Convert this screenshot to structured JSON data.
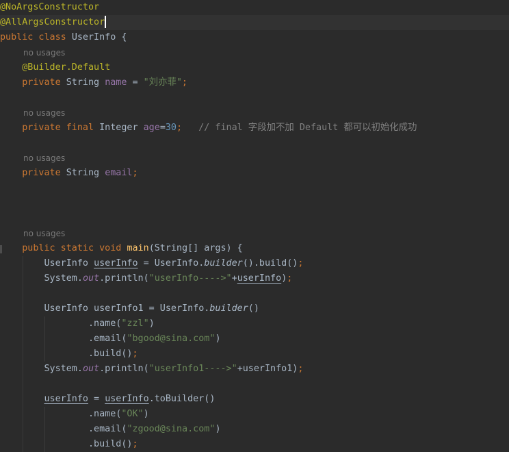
{
  "editor": {
    "lines": [
      {
        "kind": "code",
        "tokens": [
          [
            "an",
            "@NoArgsConstructor"
          ]
        ]
      },
      {
        "kind": "code",
        "current": true,
        "tokens": [
          [
            "an",
            "@AllArgsConstructor"
          ]
        ]
      },
      {
        "kind": "code",
        "tokens": [
          [
            "kw",
            "public class "
          ],
          [
            "tx",
            "UserInfo {"
          ]
        ]
      },
      {
        "kind": "hint",
        "text": "no usages"
      },
      {
        "kind": "code",
        "tokens": [
          [
            "tx",
            "    "
          ],
          [
            "an",
            "@Builder.Default"
          ]
        ]
      },
      {
        "kind": "code",
        "tokens": [
          [
            "tx",
            "    "
          ],
          [
            "kw",
            "private "
          ],
          [
            "tx",
            "String "
          ],
          [
            "fd",
            "name"
          ],
          [
            "tx",
            " = "
          ],
          [
            "st",
            "\"刘亦菲\""
          ],
          [
            "kw",
            ";"
          ]
        ]
      },
      {
        "kind": "blank"
      },
      {
        "kind": "hint",
        "text": "no usages"
      },
      {
        "kind": "code",
        "tokens": [
          [
            "tx",
            "    "
          ],
          [
            "kw",
            "private final "
          ],
          [
            "tx",
            "Integer "
          ],
          [
            "fd",
            "age"
          ],
          [
            "tx",
            "="
          ],
          [
            "nu",
            "30"
          ],
          [
            "kw",
            ";"
          ],
          [
            "tx",
            "   "
          ],
          [
            "cm",
            "// final 字段加不加 Default 都可以初始化成功"
          ]
        ]
      },
      {
        "kind": "blank"
      },
      {
        "kind": "hint",
        "text": "no usages"
      },
      {
        "kind": "code",
        "tokens": [
          [
            "tx",
            "    "
          ],
          [
            "kw",
            "private "
          ],
          [
            "tx",
            "String "
          ],
          [
            "fd",
            "email"
          ],
          [
            "kw",
            ";"
          ]
        ]
      },
      {
        "kind": "blank"
      },
      {
        "kind": "blank"
      },
      {
        "kind": "blank"
      },
      {
        "kind": "hint",
        "text": "no usages"
      },
      {
        "kind": "code",
        "tokens": [
          [
            "tx",
            "    "
          ],
          [
            "kw",
            "public static void "
          ],
          [
            "fn",
            "main"
          ],
          [
            "tx",
            "(String[] args) {"
          ]
        ]
      },
      {
        "kind": "code",
        "tokens": [
          [
            "tx",
            "        UserInfo "
          ],
          [
            "ul",
            "userInfo"
          ],
          [
            "tx",
            " = UserInfo."
          ],
          [
            "it",
            "builder"
          ],
          [
            "tx",
            "().build()"
          ],
          [
            "kw",
            ";"
          ]
        ]
      },
      {
        "kind": "code",
        "tokens": [
          [
            "tx",
            "        System."
          ],
          [
            "sf",
            "out"
          ],
          [
            "tx",
            ".println("
          ],
          [
            "st",
            "\"userInfo---->\""
          ],
          [
            "tx",
            "+"
          ],
          [
            "ul",
            "userInfo"
          ],
          [
            "tx",
            ")"
          ],
          [
            "kw",
            ";"
          ]
        ]
      },
      {
        "kind": "blank"
      },
      {
        "kind": "code",
        "tokens": [
          [
            "tx",
            "        UserInfo userInfo1 = UserInfo."
          ],
          [
            "it",
            "builder"
          ],
          [
            "tx",
            "()"
          ]
        ]
      },
      {
        "kind": "code",
        "tokens": [
          [
            "tx",
            "                .name("
          ],
          [
            "st",
            "\"zzl\""
          ],
          [
            "tx",
            ")"
          ]
        ]
      },
      {
        "kind": "code",
        "tokens": [
          [
            "tx",
            "                .email("
          ],
          [
            "st",
            "\"bgood@sina.com\""
          ],
          [
            "tx",
            ")"
          ]
        ]
      },
      {
        "kind": "code",
        "tokens": [
          [
            "tx",
            "                .build()"
          ],
          [
            "kw",
            ";"
          ]
        ]
      },
      {
        "kind": "code",
        "tokens": [
          [
            "tx",
            "        System."
          ],
          [
            "sf",
            "out"
          ],
          [
            "tx",
            ".println("
          ],
          [
            "st",
            "\"userInfo1---->\""
          ],
          [
            "tx",
            "+userInfo1)"
          ],
          [
            "kw",
            ";"
          ]
        ]
      },
      {
        "kind": "blank"
      },
      {
        "kind": "code",
        "tokens": [
          [
            "tx",
            "        "
          ],
          [
            "ul",
            "userInfo"
          ],
          [
            "tx",
            " = "
          ],
          [
            "ul",
            "userInfo"
          ],
          [
            "tx",
            ".toBuilder()"
          ]
        ]
      },
      {
        "kind": "code",
        "tokens": [
          [
            "tx",
            "                .name("
          ],
          [
            "st",
            "\"OK\""
          ],
          [
            "tx",
            ")"
          ]
        ]
      },
      {
        "kind": "code",
        "tokens": [
          [
            "tx",
            "                .email("
          ],
          [
            "st",
            "\"zgood@sina.com\""
          ],
          [
            "tx",
            ")"
          ]
        ]
      },
      {
        "kind": "code",
        "tokens": [
          [
            "tx",
            "                .build()"
          ],
          [
            "kw",
            ";"
          ]
        ]
      }
    ]
  }
}
